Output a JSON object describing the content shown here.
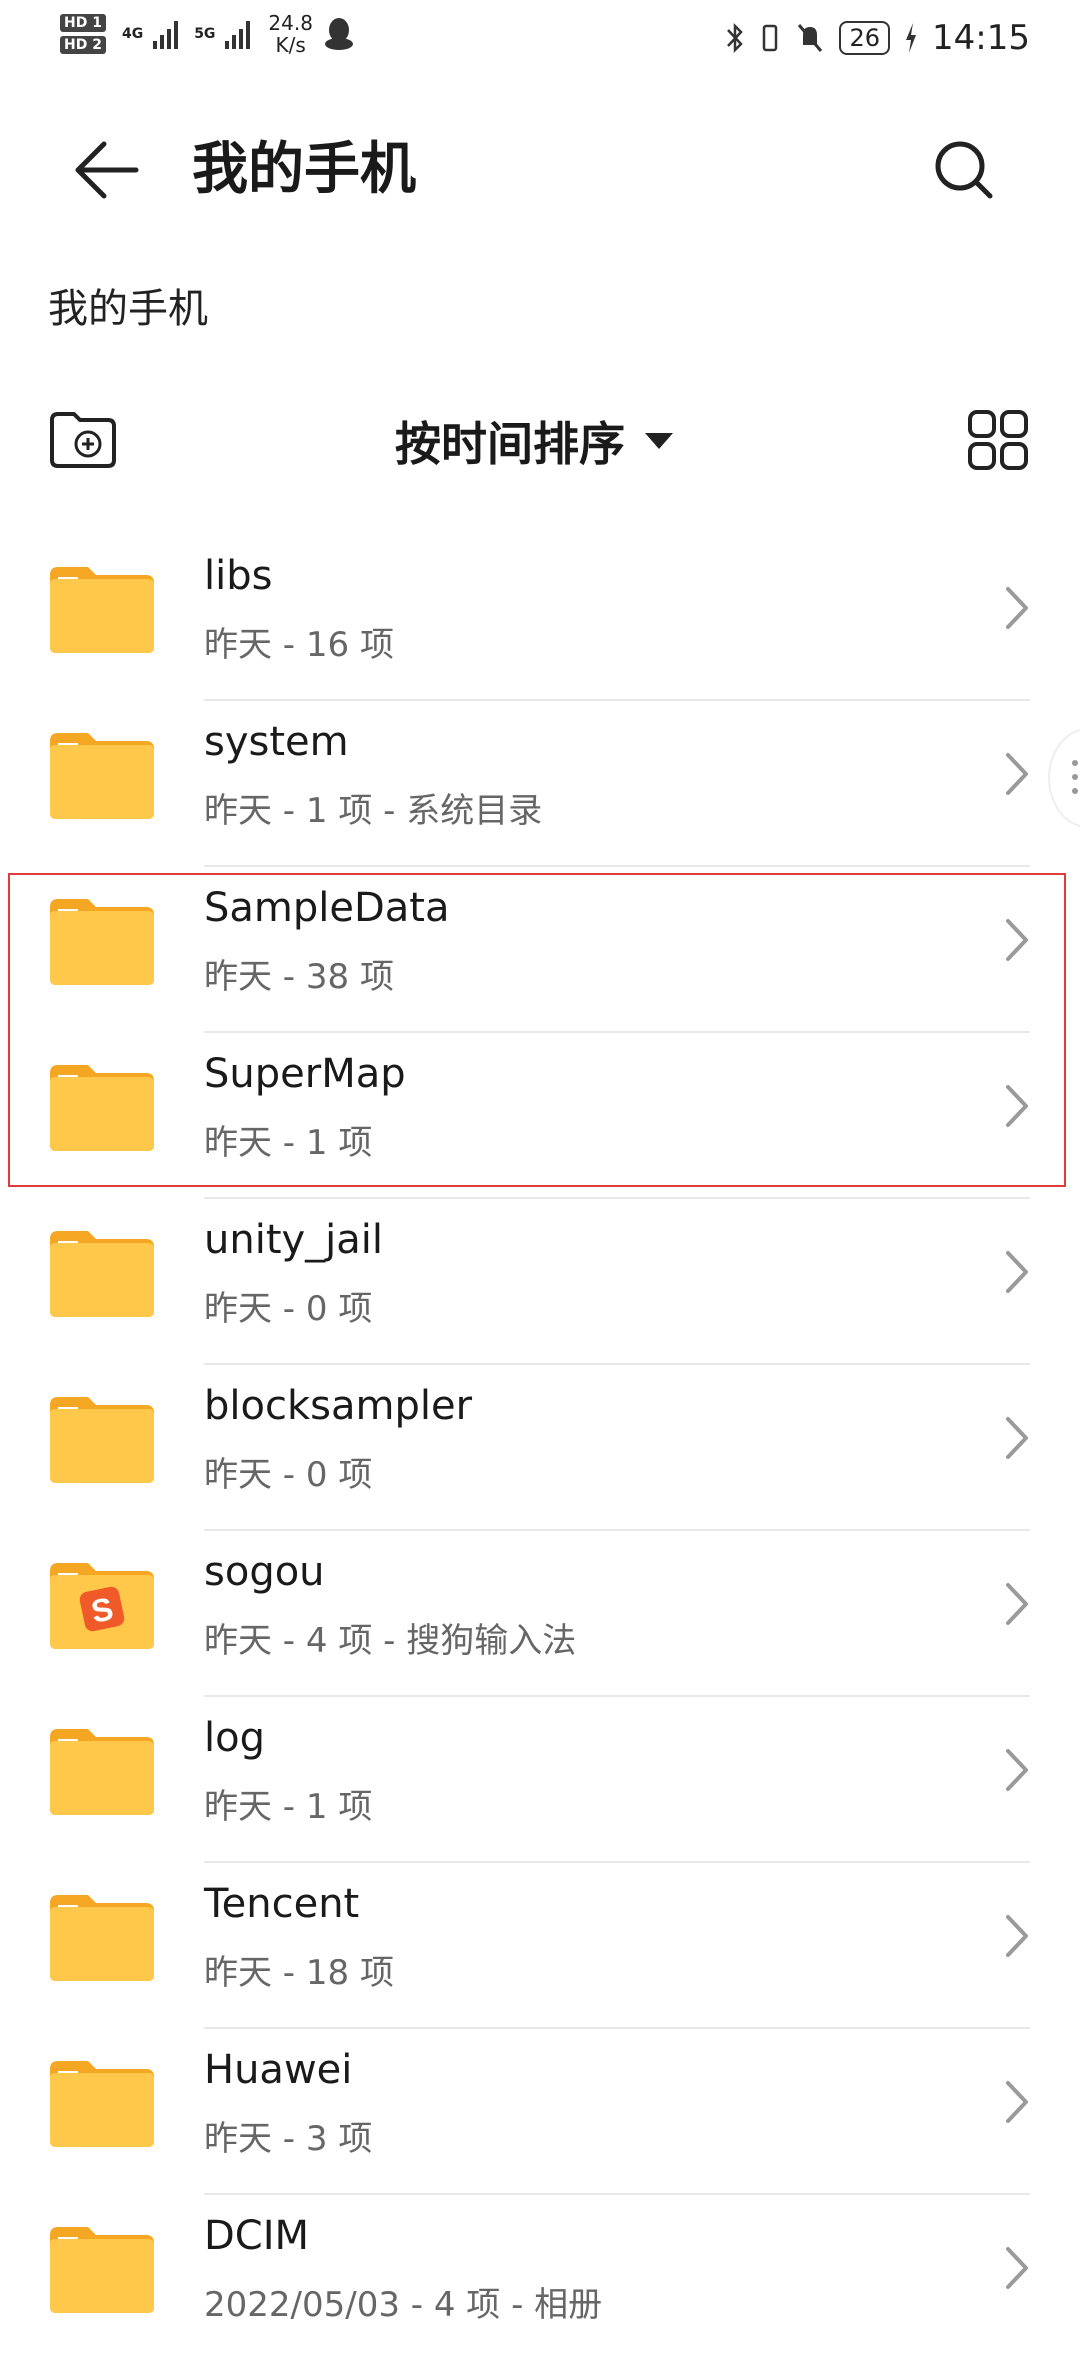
{
  "status_bar": {
    "hd1": "HD 1",
    "hd2": "HD 2",
    "net1": "4G",
    "net2": "5G",
    "speed_value": "24.8",
    "speed_unit": "K/s",
    "battery": "26",
    "time": "14:15"
  },
  "header": {
    "title": "我的手机"
  },
  "breadcrumb": "我的手机",
  "toolbar": {
    "sort_label": "按时间排序"
  },
  "files": [
    {
      "name": "libs",
      "meta": "昨天 - 16 项",
      "icon": "folder-icon"
    },
    {
      "name": "system",
      "meta": "昨天 - 1 项 - 系统目录",
      "icon": "folder-icon"
    },
    {
      "name": "SampleData",
      "meta": "昨天 - 38 项",
      "icon": "folder-icon"
    },
    {
      "name": "SuperMap",
      "meta": "昨天 - 1 项",
      "icon": "folder-icon"
    },
    {
      "name": "unity_jail",
      "meta": "昨天 - 0 项",
      "icon": "folder-icon"
    },
    {
      "name": "blocksampler",
      "meta": "昨天 - 0 项",
      "icon": "folder-icon"
    },
    {
      "name": "sogou",
      "meta": "昨天 - 4 项 - 搜狗输入法",
      "icon": "sogou-folder-icon"
    },
    {
      "name": "log",
      "meta": "昨天 - 1 项",
      "icon": "folder-icon"
    },
    {
      "name": "Tencent",
      "meta": "昨天 - 18 项",
      "icon": "folder-icon"
    },
    {
      "name": "Huawei",
      "meta": "昨天 - 3 项",
      "icon": "folder-icon"
    },
    {
      "name": "DCIM",
      "meta": "2022/05/03 - 4 项 - 相册",
      "icon": "folder-icon"
    }
  ],
  "colors": {
    "folder": "#ffc84a",
    "folder_tab": "#f5a623",
    "highlight": "#e23b3b",
    "sogou": "#f05a28"
  }
}
